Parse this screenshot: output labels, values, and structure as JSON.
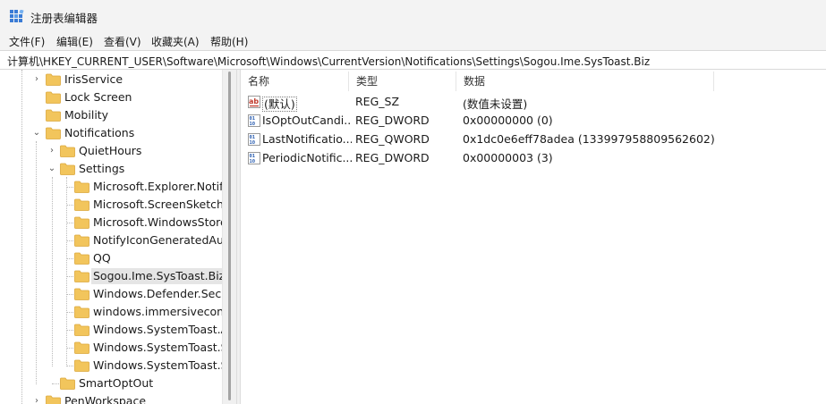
{
  "window": {
    "title": "注册表编辑器"
  },
  "menu": [
    "文件(F)",
    "编辑(E)",
    "查看(V)",
    "收藏夹(A)",
    "帮助(H)"
  ],
  "address": "计算机\\HKEY_CURRENT_USER\\Software\\Microsoft\\Windows\\CurrentVersion\\Notifications\\Settings\\Sogou.Ime.SysToast.Biz",
  "tree": [
    {
      "label": "IrisService",
      "toggle": "›"
    },
    {
      "label": "Lock Screen",
      "toggle": ""
    },
    {
      "label": "Mobility",
      "toggle": ""
    },
    {
      "label": "Notifications",
      "toggle": "⌄"
    },
    {
      "label": "QuietHours",
      "toggle": "›"
    },
    {
      "label": "Settings",
      "toggle": "⌄"
    },
    {
      "label": "Microsoft.Explorer.Notifi",
      "toggle": ""
    },
    {
      "label": "Microsoft.ScreenSketch_",
      "toggle": ""
    },
    {
      "label": "Microsoft.WindowsStore",
      "toggle": ""
    },
    {
      "label": "NotifyIconGeneratedAum",
      "toggle": ""
    },
    {
      "label": "QQ",
      "toggle": ""
    },
    {
      "label": "Sogou.Ime.SysToast.Biz",
      "toggle": "",
      "selected": true
    },
    {
      "label": "Windows.Defender.Secu",
      "toggle": ""
    },
    {
      "label": "windows.immersivecontr",
      "toggle": ""
    },
    {
      "label": "Windows.SystemToast.Au",
      "toggle": ""
    },
    {
      "label": "Windows.SystemToast.Se",
      "toggle": ""
    },
    {
      "label": "Windows.SystemToast.St",
      "toggle": ""
    },
    {
      "label": "SmartOptOut",
      "toggle": ""
    },
    {
      "label": "PenWorkspace",
      "toggle": "›"
    }
  ],
  "list": {
    "columns": [
      "名称",
      "类型",
      "数据"
    ],
    "rows": [
      {
        "icon": "string-value-icon",
        "name": "(默认)",
        "type": "REG_SZ",
        "data": "(数值未设置)"
      },
      {
        "icon": "binary-value-icon",
        "name": "IsOptOutCandi...",
        "type": "REG_DWORD",
        "data": "0x00000000 (0)"
      },
      {
        "icon": "binary-value-icon",
        "name": "LastNotificatio...",
        "type": "REG_QWORD",
        "data": "0x1dc0e6eff78adea (133997958809562602)"
      },
      {
        "icon": "binary-value-icon",
        "name": "PeriodicNotific...",
        "type": "REG_DWORD",
        "data": "0x00000003 (3)"
      }
    ]
  },
  "colors": {
    "folder": "#f2c55c",
    "folder_dark": "#dba73a",
    "selected_bg": "#e5e5e5",
    "chrome_bg": "#f3f3f3"
  }
}
